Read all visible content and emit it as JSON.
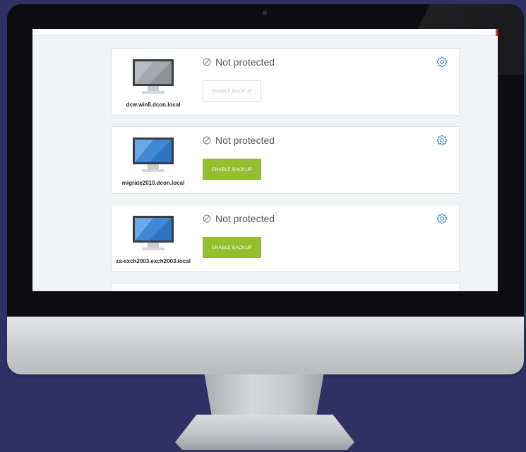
{
  "theme": {
    "accent": "#93c02f",
    "background": "#2d3163",
    "status_text": "#555a60"
  },
  "machines": [
    {
      "hostname": "dcw.win8.dcon.local",
      "status": "Not protected",
      "status_icon": "prohibited-icon",
      "button_label": "ENABLE BACKUP",
      "button_state": "disabled",
      "monitor_state": "off"
    },
    {
      "hostname": "migrate2010.dcon.local",
      "status": "Not protected",
      "status_icon": "prohibited-icon",
      "button_label": "ENABLE BACKUP",
      "button_state": "enabled",
      "monitor_state": "on"
    },
    {
      "hostname": "za-exch2003.exch2003.local",
      "status": "Not protected",
      "status_icon": "prohibited-icon",
      "button_label": "ENABLE BACKUP",
      "button_state": "enabled",
      "monitor_state": "on"
    }
  ]
}
